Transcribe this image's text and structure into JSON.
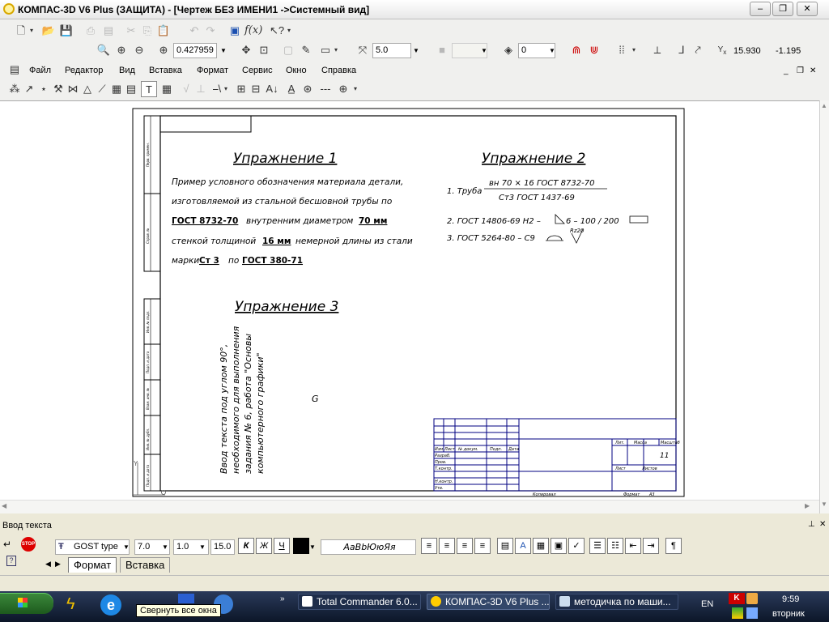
{
  "window": {
    "title": "КОМПАС-3D V6 Plus (ЗАЩИТА) - [Чертеж БЕЗ ИМЕНИ1 ->Системный вид]"
  },
  "toolbar": {
    "zoom_value": "0.427959",
    "step_value": "5.0",
    "layer_value": "0",
    "coord_x": "15.930",
    "coord_y": "-1.195"
  },
  "menu": [
    "Файл",
    "Редактор",
    "Вид",
    "Вставка",
    "Формат",
    "Сервис",
    "Окно",
    "Справка"
  ],
  "drawing": {
    "ex1_title": "Упражнение 1",
    "ex1_lines": [
      "Пример условного обозначения материала детали,",
      "изготовляемой из стальной бесшовной трубы по",
      "стенкой толщиной",
      "марки"
    ],
    "ex1_gost": "ГОСТ 8732-70",
    "ex1_inner": "внутренним диаметром",
    "ex1_diam": "70 мм",
    "ex1_thick": "16 мм",
    "ex1_rest": "немерной длины из стали",
    "ex1_grade": "Ст 3",
    "ex1_po": "по",
    "ex1_gost2": "ГОСТ 380-71",
    "ex2_title": "Упражнение 2",
    "ex2_item1_label": "1. Труба",
    "ex2_item1_num": "вн 70 × 16 ГОСТ 8732-70",
    "ex2_item1_den": "Ст3 ГОСТ 1437-69",
    "ex2_item2": "2. ГОСТ 14806-69 Н2 –",
    "ex2_item2_tail": "6 – 100 / 200",
    "ex2_item3": "3. ГОСТ 5264-80 – С9",
    "ex2_item3_sup": "Rz20",
    "ex3_title": "Упражнение 3",
    "ex3_lines": [
      "Ввод текста под углом 90°,",
      "необходимого для выполнения",
      "задания № 6, работа \"Основы",
      "компьютерного графики\""
    ],
    "stamp_format_label": "Формат",
    "stamp_format_value": "А3",
    "stamp_copy_label": "Копировал",
    "stamp_sheets": "11",
    "stamp_cols": [
      "Лит.",
      "Масса",
      "Масштаб"
    ],
    "stamp_rows": [
      "Изм.",
      "Лист",
      "№ докум.",
      "Подп.",
      "Дата"
    ],
    "stamp_left_rows": [
      "Разраб.",
      "Пров.",
      "Т.контр.",
      "Н.контр.",
      "Утв."
    ],
    "stamp_sheet_label": "Лист",
    "stamp_sheets_label": "Листов",
    "side_labels": [
      "Перв. примен.",
      "Справ. №",
      "Инв. № подл.",
      "Подп. и дата",
      "Взам. инв. №",
      "Инв. № дубл.",
      "Подп. и дата"
    ],
    "cursor_symbol": "G"
  },
  "panel": {
    "title": "Ввод текста",
    "font_name": "GOST type",
    "font_size": "7.0",
    "line_spacing": "1.0",
    "width_value": "15.0",
    "bold": "К",
    "italic": "Ж",
    "underline": "Ч",
    "sample": "АаВbЮюЯя",
    "tab_format": "Формат",
    "tab_insert": "Вставка"
  },
  "taskbar": {
    "tooltip": "Свернуть все окна",
    "tasks": [
      "Total Commander 6.0...",
      "КОМПАС-3D V6 Plus ...",
      "методичка по маши..."
    ],
    "clock_time": "9:59",
    "clock_day": "вторник",
    "lang": "EN"
  }
}
